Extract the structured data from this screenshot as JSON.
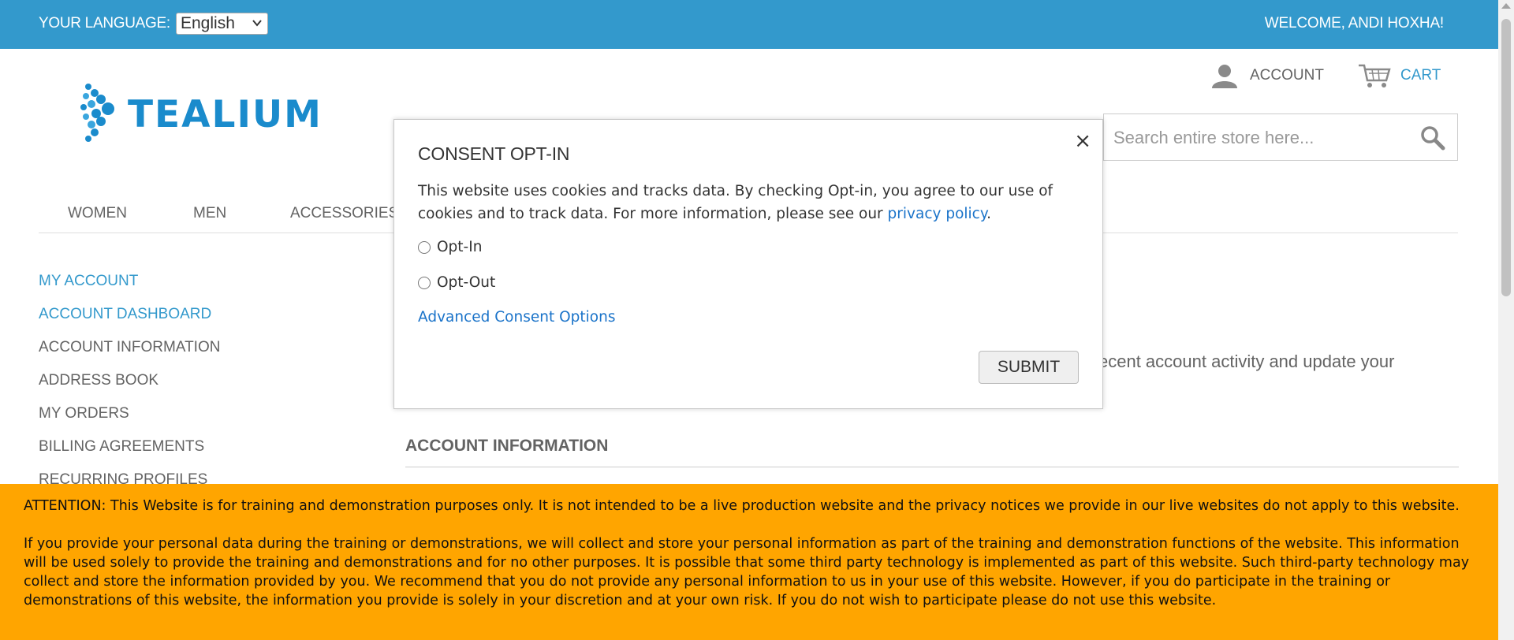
{
  "topbar": {
    "language_label": "YOUR LANGUAGE:",
    "language_selected": "English",
    "welcome": "WELCOME, ANDI HOXHA!"
  },
  "header": {
    "logo_text": "TEALIUM",
    "account_label": "ACCOUNT",
    "cart_label": "CART",
    "search_placeholder": "Search entire store here..."
  },
  "nav": {
    "items": [
      {
        "label": "WOMEN"
      },
      {
        "label": "MEN"
      },
      {
        "label": "ACCESSORIES"
      }
    ]
  },
  "sidebar": {
    "title": "MY ACCOUNT",
    "items": [
      {
        "label": "ACCOUNT DASHBOARD"
      },
      {
        "label": "ACCOUNT INFORMATION"
      },
      {
        "label": "ADDRESS BOOK"
      },
      {
        "label": "MY ORDERS"
      },
      {
        "label": "BILLING AGREEMENTS"
      },
      {
        "label": "RECURRING PROFILES"
      }
    ]
  },
  "main": {
    "intro_fragment": "ecent account activity and update your",
    "section_heading": "ACCOUNT INFORMATION"
  },
  "modal": {
    "title": "CONSENT OPT-IN",
    "body_text": "This website uses cookies and tracks data. By checking Opt-in, you agree to our use of cookies and to track data. For more information, please see our",
    "privacy_link": "privacy policy",
    "body_end": ".",
    "options": [
      {
        "label": "Opt-In"
      },
      {
        "label": "Opt-Out"
      }
    ],
    "advanced_link": "Advanced Consent Options",
    "submit_label": "SUBMIT",
    "close_symbol": "×"
  },
  "banner": {
    "paragraph1": "ATTENTION: This Website is for training and demonstration purposes only. It is not intended to be a live production website and the privacy notices we provide in our live websites do not apply to this website.",
    "paragraph2": "If you provide your personal data during the training or demonstrations, we will collect and store your personal information as part of the training and demonstration functions of the website. This information will be used solely to provide the training and demonstrations and for no other purposes. It is possible that some third party technology is implemented as part of this website. Such third-party technology may collect and store the information provided by you. We recommend that you do not provide any personal information to us in your use of this website. However, if you do participate in the training or demonstrations of this website, the information you provide is solely in your discretion and at your own risk. If you do not wish to participate please do not use this website."
  },
  "colors": {
    "topbar": "#3399cc",
    "brand": "#1a8bcc",
    "banner": "#ffa500",
    "link": "#1a73c9"
  }
}
